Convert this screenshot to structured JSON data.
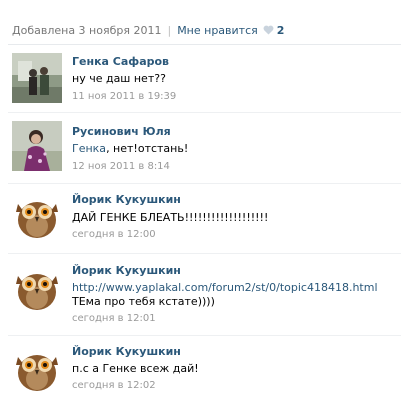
{
  "header": {
    "added_text": "Добавлена 3 ноября 2011",
    "like_label": "Мне нравится",
    "like_count": "2"
  },
  "comments": [
    {
      "author": "Генка Сафаров",
      "text": "ну че даш нет??",
      "date": "11 ноя 2011 в 19:39",
      "avatar": "photo-avatar"
    },
    {
      "author": "Русинович Юля",
      "reply_to": "Генка",
      "text": ", нет!отстань!",
      "date": "12 ноя 2011 в 8:14",
      "avatar": "photo-avatar"
    },
    {
      "author": "Йорик Кукушкин",
      "text": "ДАЙ ГЕНКЕ БЛЕАТЬ!!!!!!!!!!!!!!!!!!!",
      "date": "сегодня в 12:00",
      "avatar": "owl-avatar"
    },
    {
      "author": "Йорик Кукушкин",
      "link": "http://www.yaplakal.com/forum2/st/0/topic418418.html",
      "text": " ТЕма про тебя кстате))))",
      "date": "сегодня в 12:01",
      "avatar": "owl-avatar"
    },
    {
      "author": "Йорик Кукушкин",
      "text": "п.с а Генке всеж дай!",
      "date": "сегодня в 12:02",
      "avatar": "owl-avatar"
    }
  ],
  "colors": {
    "link": "#2b587a",
    "muted": "#999999",
    "heart": "#c9d3dd"
  }
}
